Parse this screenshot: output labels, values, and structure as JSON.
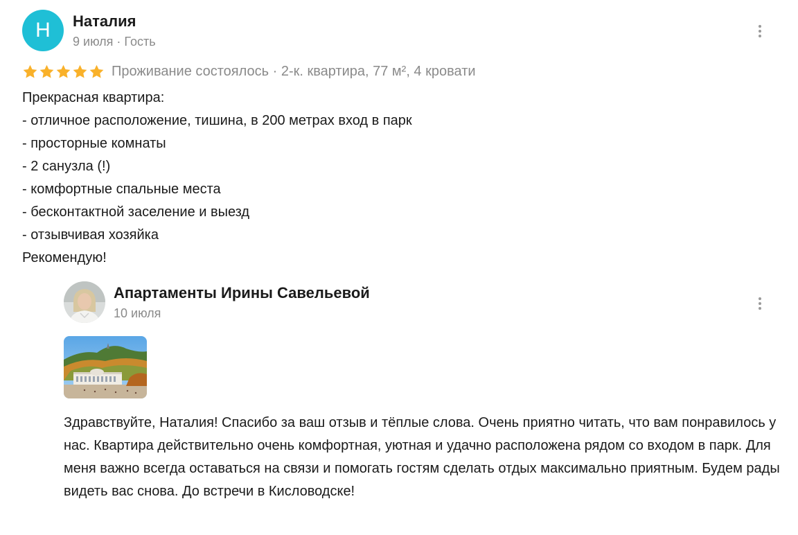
{
  "review": {
    "avatar_letter": "Н",
    "author": "Наталия",
    "meta": "9 июля · Гость",
    "rating": 5,
    "rating_max": 5,
    "stay_info": "Проживание состоялось · 2-к. квартира, 77 м², 4 кровати",
    "text_lines": [
      "Прекрасная квартира:",
      "- отличное расположение, тишина, в 200 метрах вход в парк",
      "- просторные комнаты",
      "- 2 санузла (!)",
      "- комфортные спальные места",
      "- бесконтактной заселение и выезд",
      "- отзывчивая хозяйка",
      "Рекомендую!"
    ]
  },
  "reply": {
    "author": "Апартаменты Ирины Савельевой",
    "date": "10 июля",
    "text": "Здравствуйте, Наталия! Спасибо за ваш отзыв и тёплые слова. Очень приятно читать, что вам понравилось у нас. Квартира действительно очень комфортная, уютная и удачно расположена рядом со входом в парк. Для меня важно всегда оставаться на связи и помогать гостям сделать отдых максимально приятным. Будем рады видеть вас снова. До встречи в Кисловодске!"
  },
  "icons": {
    "star": "star-icon",
    "menu": "more-vertical-icon"
  },
  "colors": {
    "avatar_bg": "#1fbfd6",
    "star": "#f9b12a",
    "meta_text": "#8a8a8a",
    "primary_text": "#1a1a1a"
  }
}
